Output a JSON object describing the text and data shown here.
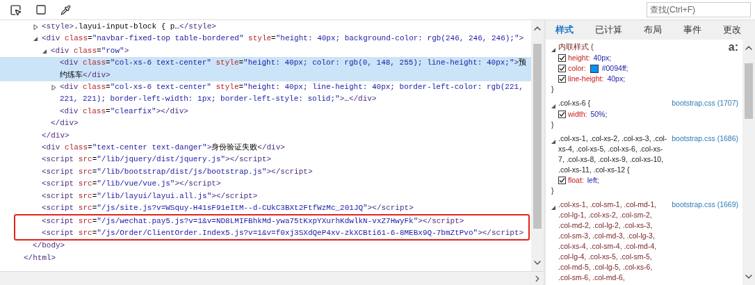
{
  "toolbar": {
    "search": {
      "placeholder": "查找(Ctrl+F)"
    }
  },
  "dom_tree": {
    "nodes": [
      {
        "close": "</html>",
        "children": [
          {
            "close": "</body>",
            "children": [
              {
                "open": "<style>.layui-input-block { p…</style>",
                "expanded": false,
                "selected": false,
                "boxed": false
              },
              {
                "open": "<div class=\"navbar-fixed-top table-bordered\" style=\"height: 40px; background-color: rgb(246, 246, 246);\">",
                "expanded": true,
                "selected": false,
                "close": "</div>",
                "children": [
                  {
                    "open": "<div class=\"row\">",
                    "expanded": true,
                    "selected": false,
                    "close": "</div>",
                    "children": [
                      {
                        "open": "<div class=\"col-xs-6 text-center\" style=\"height: 40px; color: rgb(0, 148, 255); line-height: 40px;\">预约练车</div>",
                        "selected": true,
                        "boxed": false
                      },
                      {
                        "open": "<div class=\"col-xs-6 text-center\" style=\"height: 40px; line-height: 40px; border-left-color: rgb(221, 221, 221); border-left-width: 1px; border-left-style: solid;\">…</div>",
                        "expanded": false,
                        "selected": false,
                        "boxed": false
                      },
                      {
                        "open": "<div class=\"clearfix\"></div>",
                        "selected": false,
                        "boxed": false
                      }
                    ]
                  }
                ]
              },
              {
                "open": "<div class=\"text-center text-danger\">身份验证失败</div>",
                "selected": false,
                "boxed": false
              },
              {
                "open": "<script src=\"/lib/jquery/dist/jquery.js\"></script>",
                "selected": false,
                "boxed": false
              },
              {
                "open": "<script src=\"/lib/bootstrap/dist/js/bootstrap.js\"></script>",
                "selected": false,
                "boxed": false
              },
              {
                "open": "<script src=\"/lib/vue/vue.js\"></script>",
                "selected": false,
                "boxed": false
              },
              {
                "open": "<script src=\"/lib/layui/layui.all.js\"></script>",
                "selected": false,
                "boxed": false
              },
              {
                "open": "<script src=\"/js/site.js?v=WSquy-H41sF91eItM--d-CUkC3BXt2FtfWzMc_201JQ\"></script>",
                "selected": false,
                "boxed": false
              },
              {
                "open": "<script src=\"/js/wechat.pay5.js?v=1&v=ND8LMIFBhkMd-ywa75tKxpYXurhKdwlkN-vxZ7HwyFk\"></script>",
                "selected": false,
                "boxed": true
              },
              {
                "open": "<script src=\"/js/Order/ClientOrder.Index5.js?v=1&v=f0xj3SXdQeP4xv-zkXCBti61-6-8MEBx9Q-7bmZtPvo\"></script>",
                "selected": false,
                "boxed": true
              }
            ]
          }
        ]
      }
    ]
  },
  "styles_panel": {
    "tabs": [
      {
        "label": "样式",
        "selected": true
      },
      {
        "label": "已计算",
        "selected": false
      },
      {
        "label": "布局",
        "selected": false
      },
      {
        "label": "事件",
        "selected": false
      },
      {
        "label": "更改",
        "selected": false
      }
    ],
    "pseudo_toggle": "a:",
    "rules": [
      {
        "selector": "内联样式  {",
        "expanded": true,
        "close": "}",
        "properties": [
          {
            "name": "height:",
            "value": "40px;",
            "checked": true
          },
          {
            "name": "color:",
            "value": "#0094ff;",
            "checked": true,
            "color": "#0094ff"
          },
          {
            "name": "line-height:",
            "value": "40px;",
            "checked": true
          }
        ]
      },
      {
        "selector": ".col-xs-6  {",
        "source": "bootstrap.css (1707)",
        "expanded": true,
        "close": "}",
        "properties": [
          {
            "name": "width:",
            "value": "50%;",
            "checked": true
          }
        ]
      },
      {
        "selector": ".col-xs-1, .col-xs-2, .col-xs-3, .col-xs-4, .col-xs-5, .col-xs-6, .col-xs-7, .col-xs-8, .col-xs-9, .col-xs-10, .col-xs-11, .col-xs-12  {",
        "source": "bootstrap.css (1686)",
        "expanded": true,
        "close": "}",
        "properties": [
          {
            "name": "float:",
            "value": "left;",
            "checked": true
          }
        ]
      },
      {
        "selector": ".col-xs-1, .col-sm-1, .col-md-1, .col-lg-1, .col-xs-2, .col-sm-2, .col-md-2, .col-lg-2, .col-xs-3, .col-sm-3, .col-md-3, .col-lg-3, .col-xs-4, .col-sm-4, .col-md-4, .col-lg-4, .col-xs-5, .col-sm-5, .col-md-5, .col-lg-5, .col-xs-6, .col-sm-6, .col-md-6,",
        "source": "bootstrap.css (1669)",
        "expanded": true
      }
    ]
  }
}
